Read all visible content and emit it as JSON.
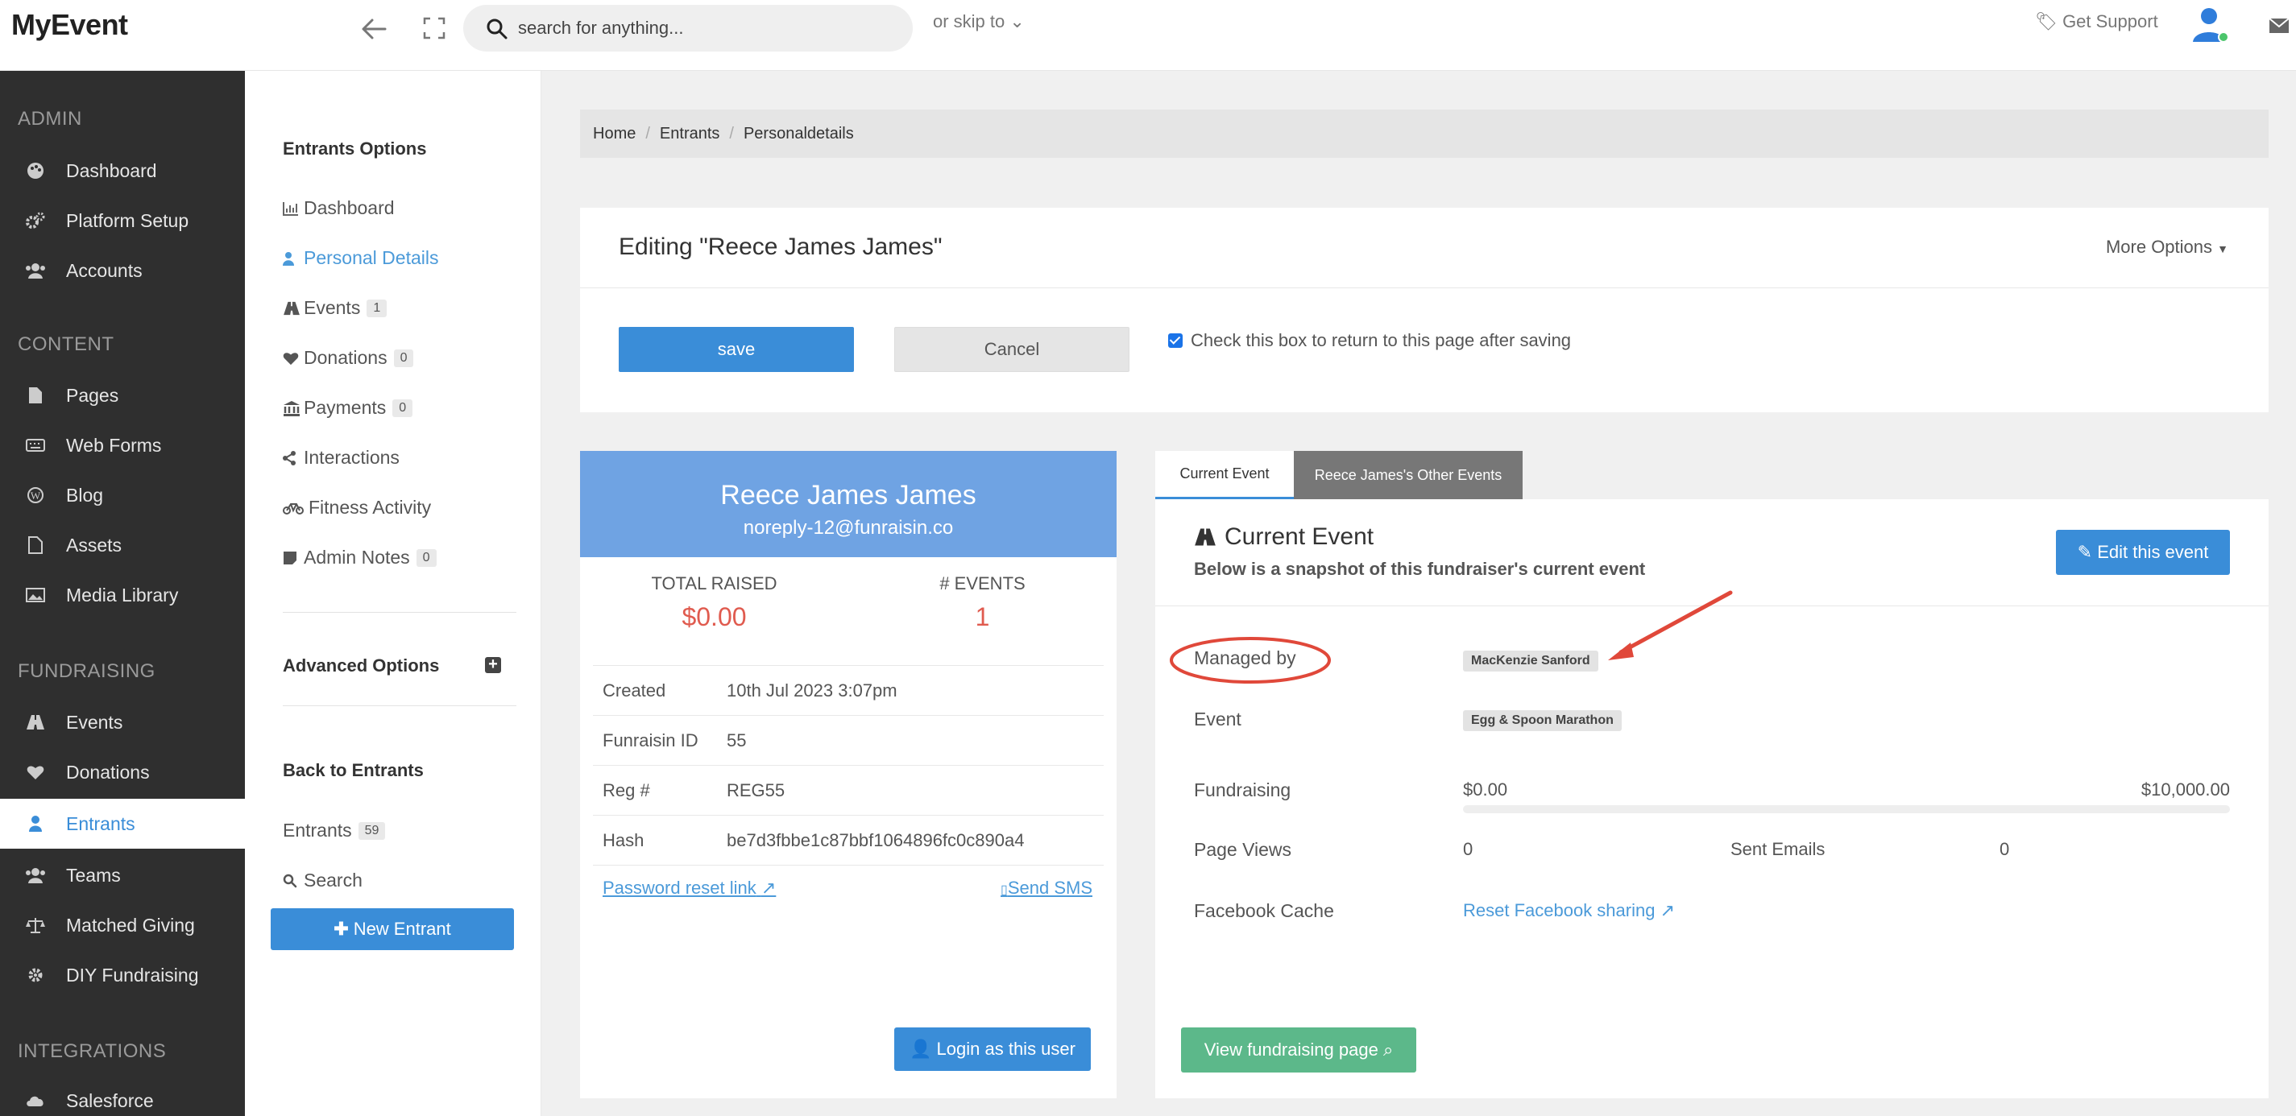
{
  "app": {
    "logo": "MyEvent"
  },
  "topbar": {
    "search_placeholder": "search for anything...",
    "skip_to": "or skip to",
    "support": "Get Support"
  },
  "sidebar": {
    "sections": [
      {
        "title": "ADMIN",
        "items": [
          {
            "label": "Dashboard",
            "icon": "palette-icon"
          },
          {
            "label": "Platform Setup",
            "icon": "cogs-icon"
          },
          {
            "label": "Accounts",
            "icon": "users-icon"
          }
        ]
      },
      {
        "title": "CONTENT",
        "items": [
          {
            "label": "Pages",
            "icon": "file-icon"
          },
          {
            "label": "Web Forms",
            "icon": "keyboard-icon"
          },
          {
            "label": "Blog",
            "icon": "wordpress-icon"
          },
          {
            "label": "Assets",
            "icon": "pdf-icon"
          },
          {
            "label": "Media Library",
            "icon": "image-icon"
          }
        ]
      },
      {
        "title": "FUNDRAISING",
        "items": [
          {
            "label": "Events",
            "icon": "road-icon"
          },
          {
            "label": "Donations",
            "icon": "heart-icon"
          },
          {
            "label": "Entrants",
            "icon": "user-icon",
            "active": true
          },
          {
            "label": "Teams",
            "icon": "users-icon"
          },
          {
            "label": "Matched Giving",
            "icon": "balance-icon"
          },
          {
            "label": "DIY Fundraising",
            "icon": "gear-icon"
          }
        ]
      },
      {
        "title": "INTEGRATIONS",
        "items": [
          {
            "label": "Salesforce",
            "icon": "cloud-icon"
          }
        ]
      }
    ]
  },
  "subnav": {
    "heading": "Entrants Options",
    "items": [
      {
        "label": "Dashboard"
      },
      {
        "label": "Personal Details"
      },
      {
        "label": "Events",
        "badge": "1"
      },
      {
        "label": "Donations",
        "badge": "0"
      },
      {
        "label": "Payments",
        "badge": "0"
      },
      {
        "label": "Interactions"
      },
      {
        "label": "Fitness Activity"
      },
      {
        "label": "Admin Notes",
        "badge": "0"
      }
    ],
    "advanced": "Advanced Options",
    "back_heading": "Back to Entrants",
    "entrants": {
      "label": "Entrants",
      "badge": "59"
    },
    "search": "Search",
    "new_entrant": "New Entrant"
  },
  "breadcrumb": [
    "Home",
    "Entrants",
    "Personaldetails"
  ],
  "editor": {
    "title": "Editing \"Reece James James\"",
    "more_options": "More Options",
    "save": "save",
    "cancel": "Cancel",
    "checkbox_label": "Check this box to return to this page after saving",
    "checkbox_checked": true
  },
  "profile": {
    "name": "Reece James James",
    "email": "noreply-12@funraisin.co",
    "total_raised_label": "TOTAL RAISED",
    "total_raised": "$0.00",
    "events_label": "# EVENTS",
    "events": "1",
    "rows": [
      {
        "k": "Created",
        "v": "10th Jul 2023 3:07pm"
      },
      {
        "k": "Funraisin ID",
        "v": "55"
      },
      {
        "k": "Reg #",
        "v": "REG55"
      },
      {
        "k": "Hash",
        "v": "be7d3fbbe1c87bbf1064896fc0c890a4"
      }
    ],
    "password_reset": "Password reset link",
    "send_sms": "Send SMS",
    "login_as": "Login as this user"
  },
  "event": {
    "tabs": [
      "Current Event",
      "Reece James's Other Events"
    ],
    "title": "Current Event",
    "subtitle": "Below is a snapshot of this fundraiser's current event",
    "edit_button": "Edit this event",
    "managed_by_label": "Managed by",
    "managed_by": "MacKenzie Sanford",
    "event_label": "Event",
    "event_name": "Egg & Spoon Marathon",
    "fundraising_label": "Fundraising",
    "raised": "$0.00",
    "target": "$10,000.00",
    "progress_fraction": 0.0,
    "page_views_label": "Page Views",
    "page_views": "0",
    "sent_emails_label": "Sent Emails",
    "sent_emails": "0",
    "facebook_label": "Facebook Cache",
    "facebook_link": "Reset Facebook sharing",
    "view_page": "View fundraising page"
  },
  "colors": {
    "accent": "#3a8dd8",
    "annotation": "#e0483a",
    "success": "#5cb88a"
  }
}
